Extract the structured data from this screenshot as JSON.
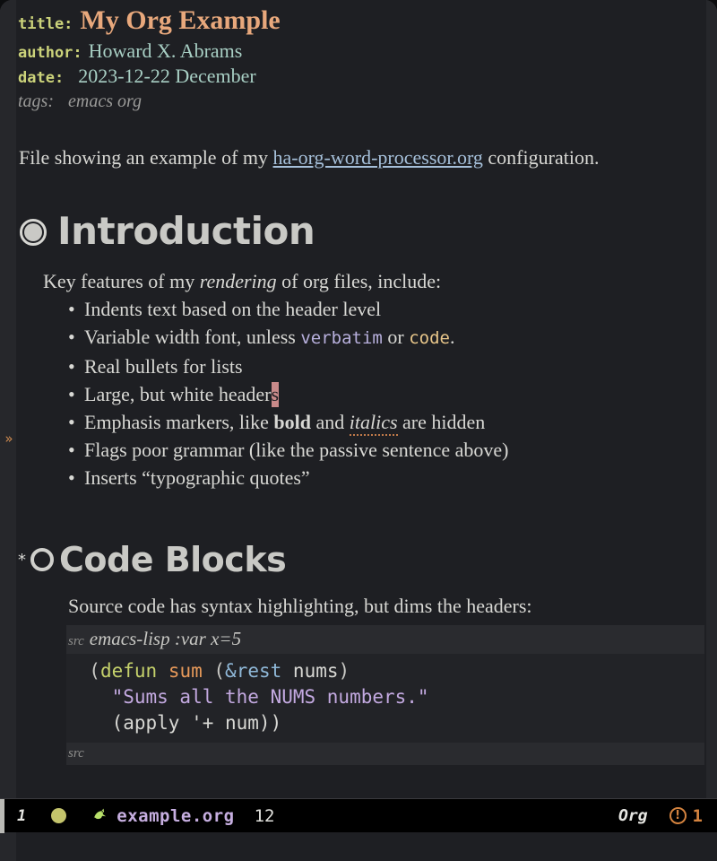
{
  "document": {
    "keywords": [
      {
        "key": "title:",
        "value": "My Org Example"
      },
      {
        "key": "author:",
        "value": "Howard X. Abrams"
      },
      {
        "key": "date:",
        "value": "2023-12-22 December"
      },
      {
        "key": "tags:",
        "value": "emacs org"
      }
    ],
    "intro": {
      "before_link": "File showing an example of my ",
      "link_text": "ha-org-word-processor.org",
      "after_link": " configuration."
    },
    "sections": [
      {
        "bullet": "circle-filled-ring-bullet",
        "heading": "Introduction",
        "lead_before_italic": "Key features of my ",
        "lead_italic": "rendering",
        "lead_after_italic": " of org files, include:",
        "items": [
          {
            "text": "Indents text based on the header level"
          },
          {
            "prefix": "Variable width font, unless ",
            "verbatim": "verbatim",
            "middle": " or ",
            "code": "code",
            "suffix": "."
          },
          {
            "text": "Real bullets for lists"
          },
          {
            "prefix": "Large, but white header",
            "cursor_char": "s",
            "suffix": ""
          },
          {
            "prefix": "Emphasis markers, like ",
            "bold": "bold",
            "middle": " and ",
            "italic": "italics",
            "suffix": " are hidden"
          },
          {
            "text": "Flags poor grammar (like the passive sentence above)"
          },
          {
            "text": "Inserts “typographic quotes”"
          }
        ]
      },
      {
        "bullet": "asterisk-ring-bullet",
        "bullet_star": "*",
        "heading": "Code Blocks",
        "lead": "Source code has syntax highlighting, but dims the headers:",
        "src_block": {
          "begin_tag": "src",
          "begin_args": "emacs-lisp :var x=5",
          "end_tag": "src",
          "lines": [
            [
              {
                "t": "  (",
                "c": "paren"
              },
              {
                "t": "defun",
                "c": "kw"
              },
              {
                "t": " ",
                "c": "var"
              },
              {
                "t": "sum",
                "c": "fn"
              },
              {
                "t": " (",
                "c": "paren"
              },
              {
                "t": "&rest",
                "c": "amp"
              },
              {
                "t": " ",
                "c": "var"
              },
              {
                "t": "nums",
                "c": "var"
              },
              {
                "t": ")",
                "c": "paren"
              }
            ],
            [
              {
                "t": "    \"Sums all the NUMS numbers.\"",
                "c": "str"
              }
            ],
            [
              {
                "t": "    (apply '+ num))",
                "c": "var"
              }
            ]
          ]
        }
      }
    ]
  },
  "fringe": {
    "marker": "»"
  },
  "modeline": {
    "window_number": "1",
    "status_dot_color": "#c4c46c",
    "major_mode_icon": "gnu-icon",
    "buffer_name": "example.org",
    "line_number": "12",
    "major_mode": "Org",
    "error_icon": "circle-exclamation-icon",
    "error_icon_glyph": "!",
    "error_count": "1"
  },
  "colors": {
    "background": "#1e1f23",
    "fringe": "#26272b",
    "foreground": "#d8d8d4",
    "keyword": "#cbd27a",
    "title": "#e8a87c",
    "meta_value": "#a8cfc4",
    "tags": "#9a9a98",
    "link": "#a6c0da",
    "heading": "#c9c9c5",
    "verbatim": "#b8b0dd",
    "code": "#e8c68a",
    "cursor": "#c98a8a",
    "modeline_bg": "#000000",
    "buffer_name": "#c6aee0",
    "error": "#d4833f",
    "src_header_bg": "#2a2b2f",
    "src_body_bg": "#222327"
  }
}
